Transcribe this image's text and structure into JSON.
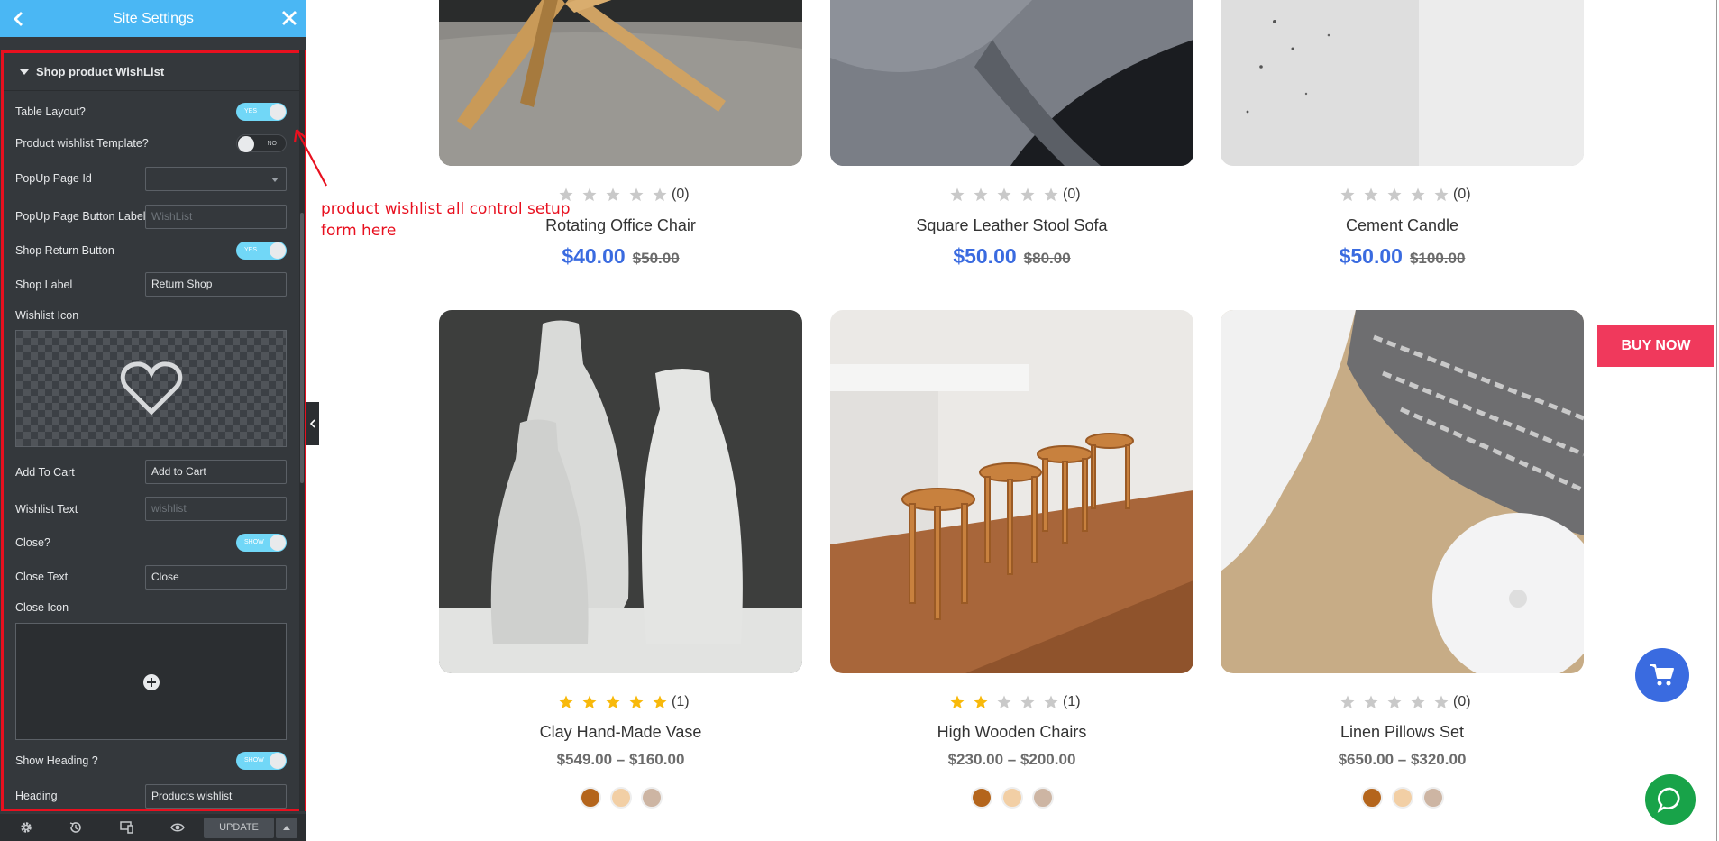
{
  "sidebar": {
    "title": "Site Settings",
    "section_title": "Shop product WishList",
    "rows": {
      "table_layout": {
        "label": "Table Layout?",
        "toggle": "YES"
      },
      "wishlist_template": {
        "label": "Product wishlist Template?",
        "toggle": "NO"
      },
      "popup_page_id": {
        "label": "PopUp Page Id",
        "value": ""
      },
      "popup_button_label": {
        "label": "PopUp Page Button Label",
        "placeholder": "WishList"
      },
      "shop_return_button": {
        "label": "Shop Return Button",
        "toggle": "YES"
      },
      "shop_label": {
        "label": "Shop Label",
        "value": "Return Shop"
      },
      "wishlist_icon": {
        "label": "Wishlist Icon"
      },
      "add_to_cart": {
        "label": "Add To Cart",
        "value": "Add to Cart"
      },
      "wishlist_text": {
        "label": "Wishlist Text",
        "placeholder": "wishlist"
      },
      "close": {
        "label": "Close?",
        "toggle": "SHOW"
      },
      "close_text": {
        "label": "Close Text",
        "value": "Close"
      },
      "close_icon": {
        "label": "Close Icon"
      },
      "show_heading": {
        "label": "Show Heading ?",
        "toggle": "SHOW"
      },
      "heading": {
        "label": "Heading",
        "value": "Products wishlist"
      }
    },
    "update_label": "UPDATE"
  },
  "annotation": {
    "line1": "product wishlist all control setup",
    "line2": "form here"
  },
  "products": [
    {
      "name": "Rotating Office Chair",
      "rating": 0,
      "count": "(0)",
      "price": "$40.00",
      "old_price": "$50.00"
    },
    {
      "name": "Square Leather Stool Sofa",
      "rating": 0,
      "count": "(0)",
      "price": "$50.00",
      "old_price": "$80.00"
    },
    {
      "name": "Cement Candle",
      "rating": 0,
      "count": "(0)",
      "price": "$50.00",
      "old_price": "$100.00"
    },
    {
      "name": "Clay Hand-Made Vase",
      "rating": 5,
      "count": "(1)",
      "price_range": "$549.00 – $160.00"
    },
    {
      "name": "High Wooden Chairs",
      "rating": 2,
      "count": "(1)",
      "price_range": "$230.00 – $200.00"
    },
    {
      "name": "Linen Pillows Set",
      "rating": 0,
      "count": "(0)",
      "price_range": "$650.00 – $320.00"
    }
  ],
  "swatch_colors": [
    "#b4651c",
    "#f2cfa5",
    "#cdb5a3"
  ],
  "buy_now_label": "BUY NOW",
  "colors": {
    "accent_blue": "#3a6be0",
    "sidebar_bg": "#34383c",
    "topbar": "#4ab7f4",
    "buy_now": "#f0395c",
    "chat": "#18a349",
    "star_filled": "#f8b90b",
    "star_empty": "#c9c9c9"
  }
}
